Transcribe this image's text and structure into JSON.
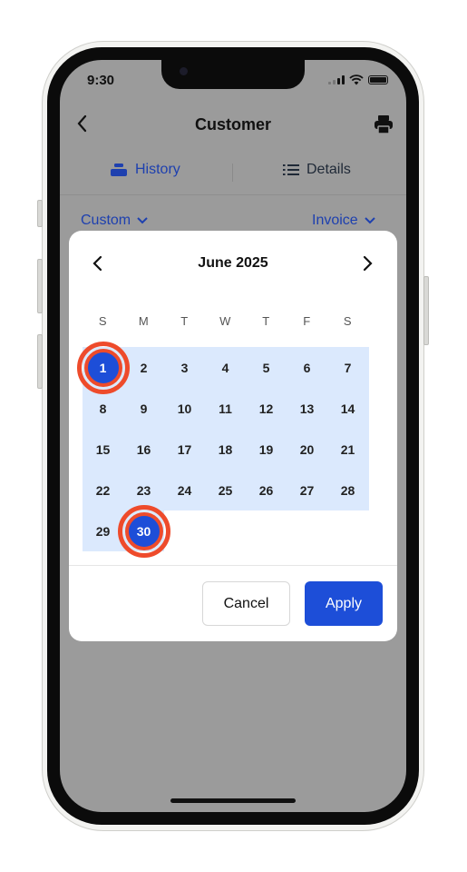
{
  "status_bar": {
    "time": "9:30"
  },
  "header": {
    "title": "Customer"
  },
  "segments": {
    "history_label": "History",
    "details_label": "Details"
  },
  "filters": {
    "range_label": "Custom",
    "type_label": "Invoice"
  },
  "calendar": {
    "month_label": "June 2025",
    "weekdays": [
      "S",
      "M",
      "T",
      "W",
      "T",
      "F",
      "S"
    ],
    "days": [
      "1",
      "2",
      "3",
      "4",
      "5",
      "6",
      "7",
      "8",
      "9",
      "10",
      "11",
      "12",
      "13",
      "14",
      "15",
      "16",
      "17",
      "18",
      "19",
      "20",
      "21",
      "22",
      "23",
      "24",
      "25",
      "26",
      "27",
      "28",
      "29",
      "30"
    ],
    "range_start": "1",
    "range_end": "30"
  },
  "actions": {
    "cancel_label": "Cancel",
    "apply_label": "Apply"
  },
  "colors": {
    "accent": "#1d4ed8",
    "range_bg": "#dbe9fd",
    "highlight_ring": "#ee4b2b",
    "overlay": "#9b9b9b"
  }
}
